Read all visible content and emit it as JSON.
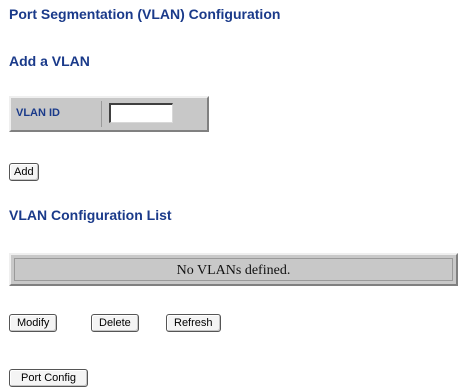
{
  "page": {
    "title": "Port Segmentation (VLAN) Configuration"
  },
  "add_section": {
    "heading": "Add a VLAN",
    "vlan_id_label": "VLAN ID",
    "vlan_id_value": "",
    "add_button_label": "Add"
  },
  "list_section": {
    "heading": "VLAN Configuration List",
    "empty_message": "No VLANs defined.",
    "buttons": {
      "modify": "Modify",
      "delete": "Delete",
      "refresh": "Refresh"
    }
  },
  "footer": {
    "port_config_label": "Port Config"
  },
  "colors": {
    "heading": "#1a3a8a",
    "panel_background": "#c8c8c8",
    "page_background": "#ffffff"
  }
}
